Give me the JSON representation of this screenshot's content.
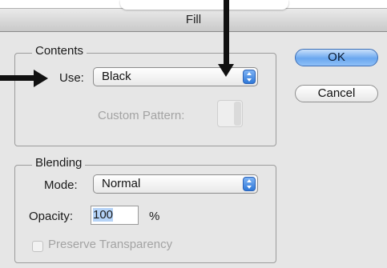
{
  "dialog": {
    "title": "Fill"
  },
  "contents": {
    "legend": "Contents",
    "use_label": "Use:",
    "use_value": "Black",
    "custom_pattern_label": "Custom Pattern:"
  },
  "blending": {
    "legend": "Blending",
    "mode_label": "Mode:",
    "mode_value": "Normal",
    "opacity_label": "Opacity:",
    "opacity_value": "100",
    "opacity_unit": "%",
    "preserve_transparency_label": "Preserve Transparency"
  },
  "buttons": {
    "ok": "OK",
    "cancel": "Cancel"
  },
  "colors": {
    "accent": "#4a8ee8",
    "window_bg": "#e6e6e6"
  }
}
